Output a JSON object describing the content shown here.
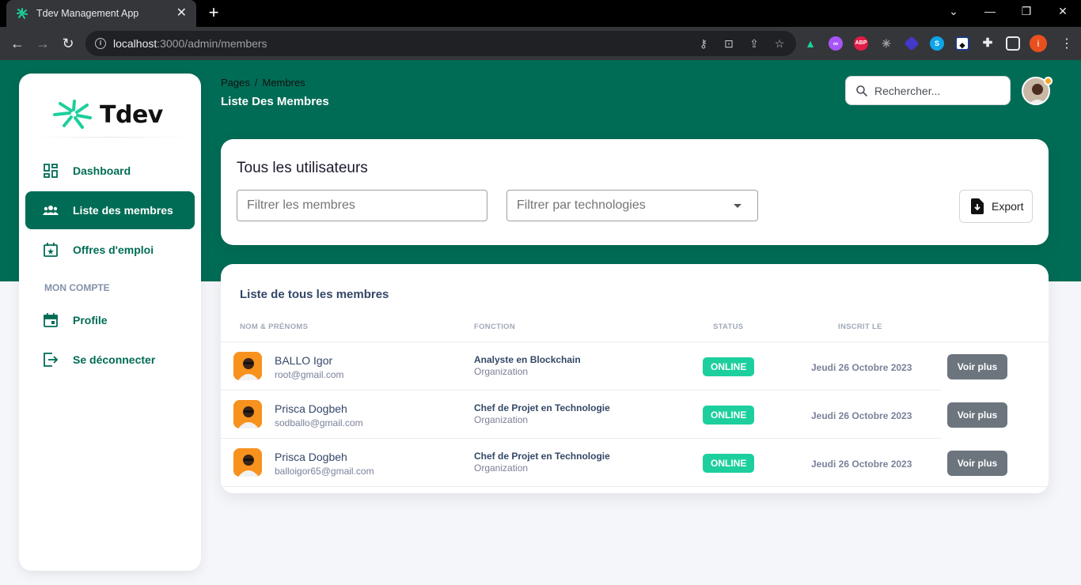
{
  "browser": {
    "tab_title": "Tdev Management App",
    "url_host": "localhost",
    "url_path": ":3000/admin/members",
    "profile_initial": "i",
    "ext_abp": "ABP"
  },
  "sidebar": {
    "logo_text": "Tdev",
    "items": [
      {
        "label": "Dashboard",
        "icon": "dashboard-icon"
      },
      {
        "label": "Liste des membres",
        "icon": "users-icon"
      },
      {
        "label": "Offres d'emploi",
        "icon": "calendar-star-icon"
      }
    ],
    "section_title": "MON COMPTE",
    "account_items": [
      {
        "label": "Profile",
        "icon": "calendar-icon"
      },
      {
        "label": "Se déconnecter",
        "icon": "logout-icon"
      }
    ],
    "accent_color": "#016c55"
  },
  "header": {
    "breadcrumb_root": "Pages",
    "breadcrumb_sep": "/",
    "breadcrumb_current": "Membres",
    "title": "Liste Des Membres",
    "search_placeholder": "Rechercher..."
  },
  "filters_card": {
    "title": "Tous les utilisateurs",
    "members_placeholder": "Filtrer les membres",
    "tech_placeholder": "Filtrer par technologies",
    "export_label": "Export"
  },
  "members_card": {
    "title": "Liste de tous les membres",
    "columns": [
      "NOM & PRÉNOMS",
      "FONCTION",
      "STATUS",
      "INSCRIT LE"
    ],
    "rows": [
      {
        "name": "BALLO Igor",
        "email": "root@gmail.com",
        "function": "Analyste en Blockchain",
        "org": "Organization",
        "status": "ONLINE",
        "date": "Jeudi 26 Octobre 2023",
        "action": "Voir plus"
      },
      {
        "name": "Prisca Dogbeh",
        "email": "sodballo@gmail.com",
        "function": "Chef de Projet en Technologie",
        "org": "Organization",
        "status": "ONLINE",
        "date": "Jeudi 26 Octobre 2023",
        "action": "Voir plus"
      },
      {
        "name": "Prisca Dogbeh",
        "email": "balloigor65@gmail.com",
        "function": "Chef de Projet en Technologie",
        "org": "Organization",
        "status": "ONLINE",
        "date": "Jeudi 26 Octobre 2023",
        "action": "Voir plus"
      }
    ],
    "status_color": "#1ccf9c"
  }
}
